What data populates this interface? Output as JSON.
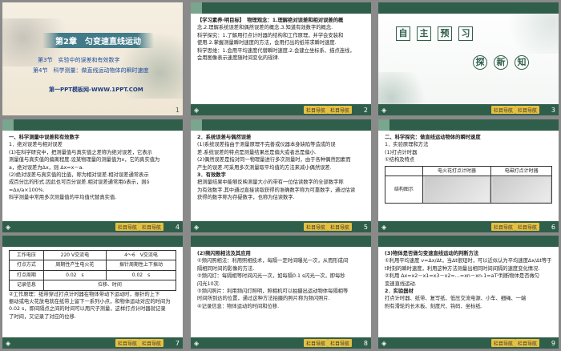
{
  "nav_buttons": {
    "prev": "栏目导航",
    "next": "栏目导航"
  },
  "slides": [
    {
      "number": "1",
      "chapter": "第2章　匀变速直线运动",
      "section": "第3节　实验中的误差和有效数字",
      "section2": "第4节　科学测量：做直线运动物体的瞬时速度",
      "footer": "第一PPT模板网-WWW.1PPT.COM"
    },
    {
      "number": "2",
      "lines": [
        "【学习素养·明目标】　物理观念：1.理解绝对误差和相对误差的概",
        "念.2.理解系统误差和偶然误差的概念.3.知道有效数字的概念.",
        "科学探究：1.了解用打点计时器的结构和工作原理，并学会安装和",
        "使用.2.掌握测量瞬时速度的方法，会用打出的纸带求瞬时速度.",
        "科学思维：1.会用平均速度代替瞬时速度.2.会建立坐标系、描点连线，",
        "会用图像表示速度随时间变化的规律."
      ]
    },
    {
      "number": "3",
      "title_chars": [
        "自",
        "主",
        "预",
        "习"
      ],
      "subtitle_chars": [
        "探",
        "新",
        "知"
      ]
    },
    {
      "number": "4",
      "lines": [
        "一、科学测量中误差和有效数字",
        "1．绝对误差与相对误差",
        "(1)在科学研究中，把测量值与真实值之差称为绝对误差，它表示",
        "测量值与真实值的偏离程度.设某物理量的测量值为x，它的真实值为",
        "a，绝对误差为Δx，则 Δx=x－a.",
        "(2)绝对误差与真实值的比值，称为相对误差.相对误差通常表示",
        "成百分比的形式.因此也可百分误差.相对误差通常用δ表示，则δ",
        "=Δx/a×100%.",
        "科学测量中常用多次测量值的平均值代替真实值."
      ]
    },
    {
      "number": "5",
      "lines": [
        "2．系统误差与偶然误差",
        "(1)系统误差指由于测量原理不完善或仪器本身缺陷等造成的误",
        "差.系统误差的特点是测量结果总是偏大或者总是偏小.",
        "(2)偶然误差是指对同一物理量进行多次测量时，由于各种偶然因素而",
        "产生的误差.可采用多次测量取平均值的方法来减小偶然误差.",
        "3．有效数字",
        "把测量结果中能够反映测量大小的带有一位估读数字的全部数字称",
        "为有效数字.其中通过直接读取获得的准确数字称为可靠数字，通过估读",
        "获得的数字称为存疑数字，也称为估读数字."
      ]
    },
    {
      "number": "6",
      "lines": [
        "二、科学探究：做直线运动物体的瞬时速度",
        "1．实验原理和方法",
        "(1)打点计时器",
        "①结构及特点"
      ],
      "table": {
        "headers": [
          "",
          "电火花打点计时器",
          "电磁打点计时器"
        ],
        "row_label": "结构图示"
      }
    },
    {
      "number": "7",
      "table": {
        "rows": [
          [
            "工作电压",
            "220 V交流电",
            "4～6　V交流电"
          ],
          [
            "打点方式",
            "周期性产生电火花",
            "振针周期性上下振动"
          ],
          [
            "打点周期",
            "0.02　s",
            "0.02　s"
          ],
          [
            "记录信息",
            "位移、时间",
            ""
          ]
        ]
      },
      "lines": [
        "②工作原理：纸带穿过打点计时器在物体带动下运动时，振针的上下",
        "振动或电火花放电就在纸带上留下一系列小点，和物体运动对应的时间为",
        "0.02 s，即间隔点之间的时间可以用尺子测量，这样打点计时器就记录",
        "了时间，又记录了对应的位移."
      ]
    },
    {
      "number": "8",
      "lines": [
        "(2)频闪照相法及其应用",
        "①频闪照相法：利用照相技术，每隔一定时间曝光一次，从而形成间",
        "隔相同时间的影像的方法.",
        "②频闪灯：每隔相等时间闪光一次，如每隔0.1 s闪光一次，即每秒",
        "闪光10次.",
        "③频闪照片：利用频闪灯照明，照相机可以拍摄出运动物体每隔相等",
        "时间所到达的位置，通过这种方法拍摄的照片称为频闪照片.",
        "④记录信息：物体运动的时间和位移."
      ]
    },
    {
      "number": "9",
      "lines": [
        "(3)物体是否做匀变速直线运动的判断方法",
        "①利用平均速度 v=Δx/Δt，当Δt很短时，可以近似认为平均速度Δx/Δt等于",
        "t时刻的瞬时速度，利用这种方法测量出相同时间间隔的速度变化情况.",
        "②利用 Δx=x2－x1=x3－x2=…=xn－xn-1=aT²判断物体是否做匀",
        "变速直线运动.",
        "2．实验器材",
        "打点计时器、纸带、复写纸、低压交流电源、小车、细绳、一端",
        "附有滑轮的长木板、刻度尺、钩码、坐标纸."
      ]
    }
  ]
}
